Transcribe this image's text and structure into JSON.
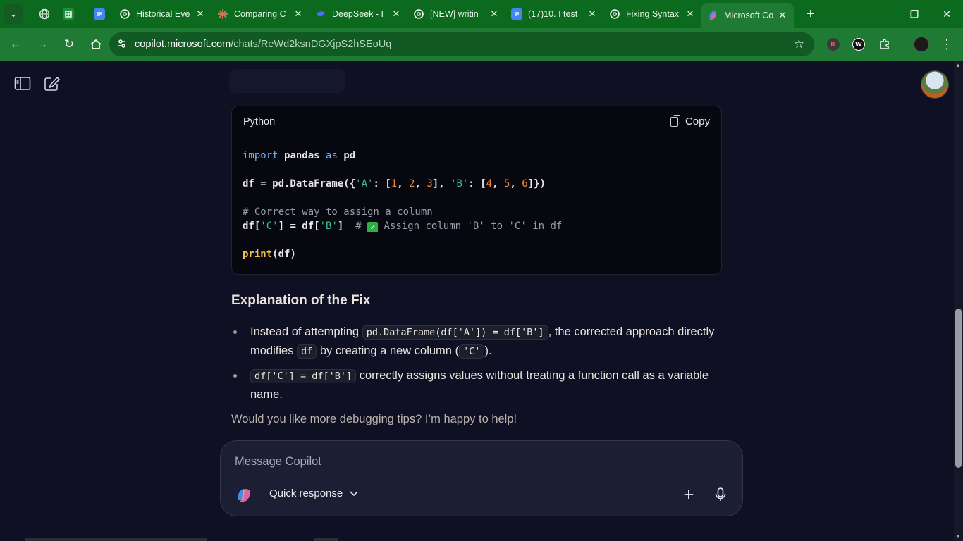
{
  "tabs": [
    {
      "label": "",
      "color": "#3a8c4a",
      "icon": "globe-icon"
    },
    {
      "label": "",
      "color": "#1e8e3e",
      "icon": "sheets-icon"
    },
    {
      "label": "",
      "color": "#4285f4",
      "icon": "docs-icon"
    },
    {
      "label": "Historical Eve",
      "color": "#ffffff",
      "icon": "openai-icon"
    },
    {
      "label": "Comparing C",
      "color": "#d97757",
      "icon": "claude-icon"
    },
    {
      "label": "DeepSeek - I",
      "color": "#4d6bfe",
      "icon": "deepseek-icon"
    },
    {
      "label": "[NEW] writin",
      "color": "#ffffff",
      "icon": "openai-icon"
    },
    {
      "label": "(17)10. I test",
      "color": "#4285f4",
      "icon": "docs-icon"
    },
    {
      "label": "Fixing Syntax",
      "color": "#ffffff",
      "icon": "openai-icon"
    },
    {
      "label": "Microsoft Co",
      "color": "#c35bd2",
      "icon": "copilot-icon"
    }
  ],
  "url": {
    "host": "copilot.microsoft.com",
    "path": "/chats/ReWd2ksnDGXjpS2hSEoUq"
  },
  "extensions": [
    "K",
    "W"
  ],
  "code": {
    "language": "Python",
    "copy_label": "Copy",
    "line1": {
      "kw1": "import",
      "mod": "pandas",
      "kw2": "as",
      "alias": "pd"
    },
    "line2": {
      "pre": "df = pd.DataFrame({",
      "s1": "'A'",
      "p1": ": [",
      "n1": "1",
      "n2": "2",
      "n3": "3",
      "p2": "], ",
      "s2": "'B'",
      "p3": ": [",
      "n4": "4",
      "n5": "5",
      "n6": "6",
      "p4": "]})",
      "comma": ", "
    },
    "comment": "# Correct way to assign a column",
    "line4": {
      "a": "df[",
      "s1": "'C'",
      "b": "] = df[",
      "s2": "'B'",
      "c": "]  ",
      "hash": "# ",
      "check": "✓",
      "cm": " Assign column 'B' to 'C' in df"
    },
    "line5": {
      "fn": "print",
      "rest": "(df)"
    }
  },
  "explanation": {
    "heading": "Explanation of the Fix",
    "b1_pre": "Instead of attempting ",
    "b1_code": "pd.DataFrame(df['A']) = df['B']",
    "b1_mid": ", the corrected approach directly modifies ",
    "b1_code2": "df",
    "b1_mid2": " by creating a new column (",
    "b1_code3": "'C'",
    "b1_end": ").",
    "b2_code": "df['C'] = df['B']",
    "b2_text": " correctly assigns values without treating a function call as a variable name."
  },
  "followup": "Would you like more debugging tips? I’m happy to help!",
  "composer": {
    "placeholder": "Message Copilot",
    "mode": "Quick response"
  }
}
